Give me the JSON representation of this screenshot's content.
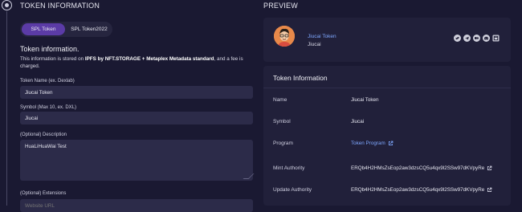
{
  "left": {
    "section_title": "TOKEN INFORMATION",
    "tabs": [
      {
        "label": "SPL Token",
        "active": true
      },
      {
        "label": "SPL Token2022",
        "active": false
      }
    ],
    "info_title": "Token information.",
    "info_desc_prefix": "This information is stored on ",
    "info_desc_bold": "IPFS by NFT.STORAGE + Metaplex Metadata standard",
    "info_desc_suffix": ", and a fee is charged.",
    "fields": {
      "name": {
        "label": "Token Name (ex. Dexlab)",
        "value": "Jiucai Token"
      },
      "symbol": {
        "label": "Symbol (Max 10, ex. DXL)",
        "value": "Jiucai"
      },
      "description": {
        "label": "(Optional) Description",
        "value": "HuaLiHuaWai Test"
      },
      "extensions": {
        "label": "(Optional) Extensions",
        "placeholder": "Website URL"
      }
    }
  },
  "right": {
    "section_title": "PREVIEW",
    "profile": {
      "name": "Jiucai Token",
      "symbol": "Jiucai",
      "social_icons": [
        "twitter-icon",
        "telegram-icon",
        "medium-icon",
        "discord-icon",
        "website-icon"
      ]
    },
    "card_title": "Token Information",
    "rows": [
      {
        "key": "Name",
        "value": "Jiucai Token"
      },
      {
        "key": "Symbol",
        "value": "Jiucai"
      },
      {
        "key": "Program",
        "value": "Token Program",
        "link": true
      },
      {
        "key": "Mint Authority",
        "value": "ERQb4H2HMsZsEop2aw3dzsCQ5u4qx9l2SSw97dKVpyRe",
        "external": true
      },
      {
        "key": "Update Authority",
        "value": "ERQb4H2HMsZsEop2aw3dzsCQ5u4qx9l2SSw97dKVpyRe",
        "external": true
      }
    ],
    "colors": {
      "link": "#7fa8ff",
      "accent": "#5b3ba6",
      "background": "#1a1932",
      "card": "#21203a"
    }
  }
}
